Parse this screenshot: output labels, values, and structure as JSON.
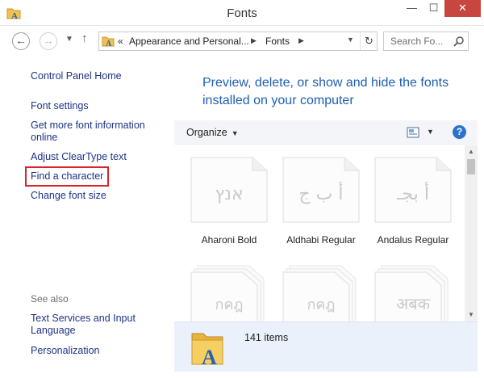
{
  "window": {
    "title": "Fonts",
    "controls": {
      "minimize": "—",
      "maximize": "☐",
      "close": "✕"
    }
  },
  "nav": {
    "back": "←",
    "forward": "→",
    "recent": "▼",
    "up": "↑",
    "address": {
      "overflow": "«",
      "segments": [
        "Appearance and Personal...",
        "Fonts"
      ],
      "separator": "▶",
      "dropdown": "▼",
      "refresh": "↻"
    },
    "search": {
      "placeholder": "Search Fo..."
    }
  },
  "sidebar": {
    "home": "Control Panel Home",
    "links": [
      "Font settings",
      "Get more font information online",
      "Adjust ClearType text",
      "Find a character",
      "Change font size"
    ],
    "highlighted_link": "Find a character",
    "highlight_color": "#d6262b",
    "see_also_label": "See also",
    "see_also": [
      "Text Services and Input Language",
      "Personalization"
    ]
  },
  "main": {
    "heading": "Preview, delete, or show and hide the fonts installed on your computer",
    "toolbar": {
      "organize": "Organize",
      "caret": "▼",
      "help": "?"
    },
    "fonts": [
      {
        "name": "Aharoni Bold",
        "glyph": "אנץ"
      },
      {
        "name": "Aldhabi Regular",
        "glyph": "أ ب ج"
      },
      {
        "name": "Andalus Regular",
        "glyph": "أ بجـ"
      },
      {
        "name": "",
        "glyph": "กคฎ"
      },
      {
        "name": "",
        "glyph": "กคฎ"
      },
      {
        "name": "",
        "glyph": "अबक"
      }
    ],
    "details": {
      "item_count": "141 items"
    }
  },
  "colors": {
    "link": "#1e3287",
    "heading": "#1e5fb0",
    "close_button": "#c7463f",
    "details_pane": "#eaf1fb"
  }
}
